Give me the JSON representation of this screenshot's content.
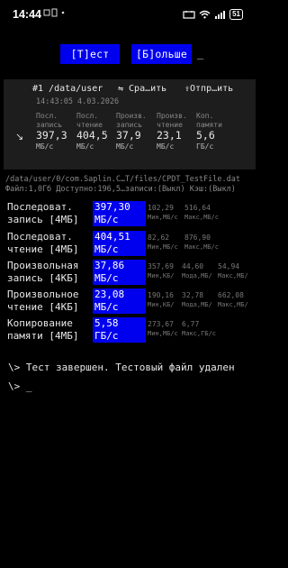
{
  "status_bar": {
    "time": "14:44",
    "battery": "51"
  },
  "toolbar": {
    "test_label": "[T]ест",
    "more_label": "[Б]ольше",
    "cursor": "_"
  },
  "result_card": {
    "title": "#1 /data/user",
    "compare_label": "⇋ Сра…ить",
    "send_label": "⇪Отпр…ить",
    "datetime": "14:43:05 4.03.2026",
    "metrics": [
      {
        "header_1": "Посл.",
        "header_2": "запись",
        "value": "397,3",
        "unit": "МБ/с"
      },
      {
        "header_1": "Посл.",
        "header_2": "чтение",
        "value": "404,5",
        "unit": "МБ/с"
      },
      {
        "header_1": "Произв.",
        "header_2": "запись",
        "value": "37,9",
        "unit": "МБ/с"
      },
      {
        "header_1": "Произв.",
        "header_2": "чтение",
        "value": "23,1",
        "unit": "МБ/с"
      },
      {
        "header_1": "Коп.",
        "header_2": "памяти",
        "value": "5,6",
        "unit": "ГБ/с"
      }
    ]
  },
  "test_file": {
    "path": "/data/user/0/com.Saplin.C…T/files/CPDT_TestFile.dat",
    "info": "Файл:1,0Гб Доступно:196,5…записи:(Выкл) Кэш:(Выкл)"
  },
  "benchmarks": [
    {
      "label_1": "Последоват.",
      "label_2": "запись [4МБ]",
      "value_1": "397,30",
      "value_2": "МБ/с",
      "stats": [
        {
          "v": "102,29",
          "u": "Мин,МБ/с"
        },
        {
          "v": "516,64",
          "u": "Макс,МБ/с"
        }
      ]
    },
    {
      "label_1": "Последоват.",
      "label_2": "чтение [4МБ]",
      "value_1": "404,51",
      "value_2": "МБ/с",
      "stats": [
        {
          "v": "82,62",
          "u": "Мин,МБ/с"
        },
        {
          "v": "876,90",
          "u": "Макс,МБ/с"
        }
      ]
    },
    {
      "label_1": "Произвольная",
      "label_2": "запись [4КБ]",
      "value_1": "37,86",
      "value_2": "МБ/с",
      "stats": [
        {
          "v": "357,69",
          "u": "Мин,КБ/"
        },
        {
          "v": "44,60",
          "u": "Мода,МБ/"
        },
        {
          "v": "54,94",
          "u": "Макс,МБ/"
        }
      ]
    },
    {
      "label_1": "Произвольное",
      "label_2": "чтение [4КБ]",
      "value_1": "23,08",
      "value_2": "МБ/с",
      "stats": [
        {
          "v": "190,16",
          "u": "Мин,КБ/"
        },
        {
          "v": "32,78",
          "u": "Мода,МБ/"
        },
        {
          "v": "662,08",
          "u": "Макс,МБ/"
        }
      ]
    },
    {
      "label_1": "Копирование",
      "label_2": "памяти [4МБ]",
      "value_1": "5,58",
      "value_2": "ГБ/с",
      "stats": [
        {
          "v": "273,67",
          "u": "Мин,МБ/с"
        },
        {
          "v": "6,77",
          "u": "Макс,ГБ/с"
        }
      ]
    }
  ],
  "benchmark_stat_extra": "с",
  "console": {
    "line_1": "\\> Тест завершен. Тестовый файл удален",
    "line_2": "\\> _"
  }
}
